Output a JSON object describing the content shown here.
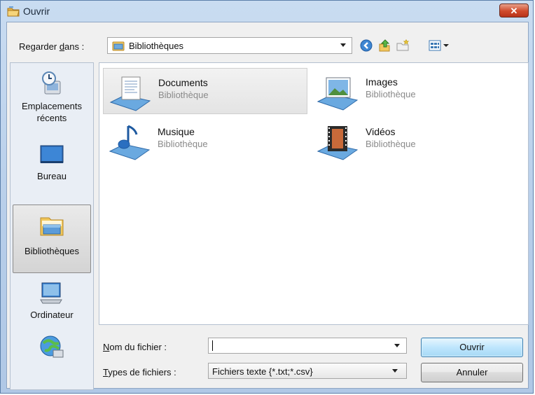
{
  "window": {
    "title": "Ouvrir",
    "close_label": "✕"
  },
  "toolbar": {
    "lookin_label_pre": "Regarder ",
    "lookin_label_u": "d",
    "lookin_label_post": "ans :",
    "lookin_value": "Bibliothèques"
  },
  "places": [
    {
      "label": "Emplacements récents",
      "icon": "recent-places-icon"
    },
    {
      "label": "Bureau",
      "icon": "desktop-icon"
    },
    {
      "label": "Bibliothèques",
      "icon": "libraries-icon",
      "selected": true
    },
    {
      "label": "Ordinateur",
      "icon": "computer-icon"
    },
    {
      "label": "",
      "icon": "network-icon"
    }
  ],
  "items": [
    {
      "name": "Documents",
      "type": "Bibliothèque",
      "icon": "documents-library-icon",
      "selected": true
    },
    {
      "name": "Images",
      "type": "Bibliothèque",
      "icon": "images-library-icon"
    },
    {
      "name": "Musique",
      "type": "Bibliothèque",
      "icon": "music-library-icon"
    },
    {
      "name": "Vidéos",
      "type": "Bibliothèque",
      "icon": "videos-library-icon"
    }
  ],
  "footer": {
    "filename_label_u": "N",
    "filename_label_rest": "om du fichier :",
    "filename_value": "",
    "filetype_label_u": "T",
    "filetype_label_rest": "ypes de fichiers :",
    "filetype_value": "Fichiers texte {*.txt;*.csv}",
    "open_label": "Ouvrir",
    "cancel_label": "Annuler"
  },
  "colors": {
    "title_bar": "#c9dcf1",
    "close_button": "#cf4a2b",
    "primary_button": "#bee6fd",
    "selection": "#e4e4e4"
  }
}
